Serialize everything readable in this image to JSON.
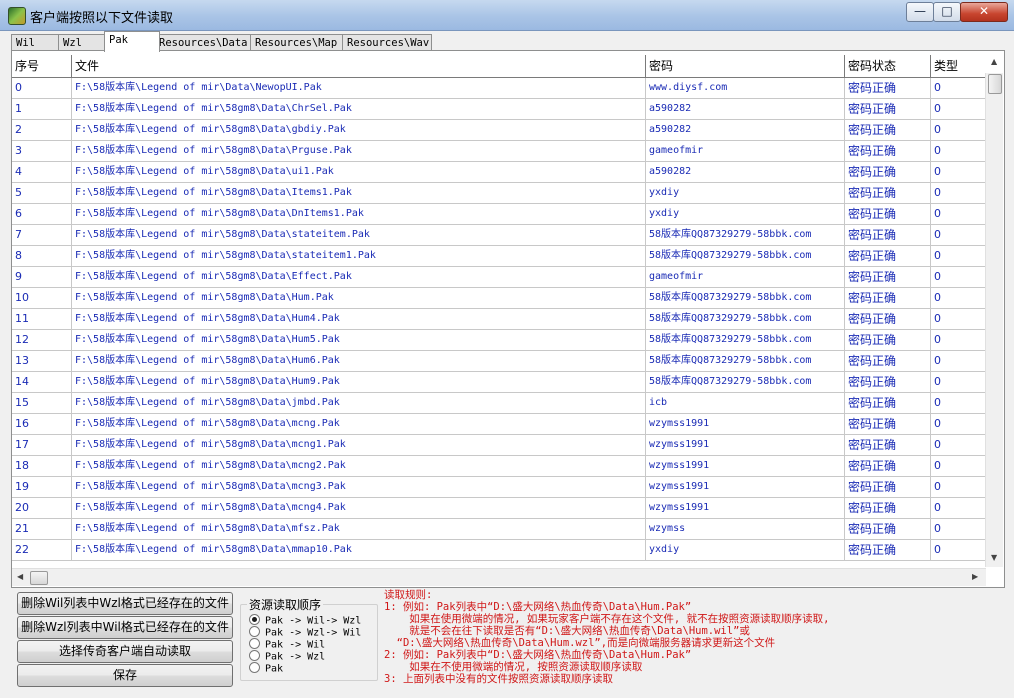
{
  "window": {
    "title": "客户端按照以下文件读取",
    "minimize": "—",
    "maximize": "□",
    "close": "✕"
  },
  "tabs": [
    "Wil",
    "Wzl",
    "Pak",
    "Resources\\Data",
    "Resources\\Map",
    "Resources\\Wav"
  ],
  "active_tab": "Pak",
  "table": {
    "headers": [
      "序号",
      "文件",
      "密码",
      "密码状态",
      "类型"
    ],
    "rows": [
      [
        "0",
        "F:\\58版本库\\Legend of mir\\Data\\NewopUI.Pak",
        "www.diysf.com",
        "密码正确",
        "0"
      ],
      [
        "1",
        "F:\\58版本库\\Legend of mir\\58gm8\\Data\\ChrSel.Pak",
        "a590282",
        "密码正确",
        "0"
      ],
      [
        "2",
        "F:\\58版本库\\Legend of mir\\58gm8\\Data\\gbdiy.Pak",
        "a590282",
        "密码正确",
        "0"
      ],
      [
        "3",
        "F:\\58版本库\\Legend of mir\\58gm8\\Data\\Prguse.Pak",
        "gameofmir",
        "密码正确",
        "0"
      ],
      [
        "4",
        "F:\\58版本库\\Legend of mir\\58gm8\\Data\\ui1.Pak",
        "a590282",
        "密码正确",
        "0"
      ],
      [
        "5",
        "F:\\58版本库\\Legend of mir\\58gm8\\Data\\Items1.Pak",
        "yxdiy",
        "密码正确",
        "0"
      ],
      [
        "6",
        "F:\\58版本库\\Legend of mir\\58gm8\\Data\\DnItems1.Pak",
        "yxdiy",
        "密码正确",
        "0"
      ],
      [
        "7",
        "F:\\58版本库\\Legend of mir\\58gm8\\Data\\stateitem.Pak",
        "58版本库QQ87329279-58bbk.com",
        "密码正确",
        "0"
      ],
      [
        "8",
        "F:\\58版本库\\Legend of mir\\58gm8\\Data\\stateitem1.Pak",
        "58版本库QQ87329279-58bbk.com",
        "密码正确",
        "0"
      ],
      [
        "9",
        "F:\\58版本库\\Legend of mir\\58gm8\\Data\\Effect.Pak",
        "gameofmir",
        "密码正确",
        "0"
      ],
      [
        "10",
        "F:\\58版本库\\Legend of mir\\58gm8\\Data\\Hum.Pak",
        "58版本库QQ87329279-58bbk.com",
        "密码正确",
        "0"
      ],
      [
        "11",
        "F:\\58版本库\\Legend of mir\\58gm8\\Data\\Hum4.Pak",
        "58版本库QQ87329279-58bbk.com",
        "密码正确",
        "0"
      ],
      [
        "12",
        "F:\\58版本库\\Legend of mir\\58gm8\\Data\\Hum5.Pak",
        "58版本库QQ87329279-58bbk.com",
        "密码正确",
        "0"
      ],
      [
        "13",
        "F:\\58版本库\\Legend of mir\\58gm8\\Data\\Hum6.Pak",
        "58版本库QQ87329279-58bbk.com",
        "密码正确",
        "0"
      ],
      [
        "14",
        "F:\\58版本库\\Legend of mir\\58gm8\\Data\\Hum9.Pak",
        "58版本库QQ87329279-58bbk.com",
        "密码正确",
        "0"
      ],
      [
        "15",
        "F:\\58版本库\\Legend of mir\\58gm8\\Data\\jmbd.Pak",
        "icb",
        "密码正确",
        "0"
      ],
      [
        "16",
        "F:\\58版本库\\Legend of mir\\58gm8\\Data\\mcng.Pak",
        "wzymss1991",
        "密码正确",
        "0"
      ],
      [
        "17",
        "F:\\58版本库\\Legend of mir\\58gm8\\Data\\mcng1.Pak",
        "wzymss1991",
        "密码正确",
        "0"
      ],
      [
        "18",
        "F:\\58版本库\\Legend of mir\\58gm8\\Data\\mcng2.Pak",
        "wzymss1991",
        "密码正确",
        "0"
      ],
      [
        "19",
        "F:\\58版本库\\Legend of mir\\58gm8\\Data\\mcng3.Pak",
        "wzymss1991",
        "密码正确",
        "0"
      ],
      [
        "20",
        "F:\\58版本库\\Legend of mir\\58gm8\\Data\\mcng4.Pak",
        "wzymss1991",
        "密码正确",
        "0"
      ],
      [
        "21",
        "F:\\58版本库\\Legend of mir\\58gm8\\Data\\mfsz.Pak",
        "wzymss",
        "密码正确",
        "0"
      ],
      [
        "22",
        "F:\\58版本库\\Legend of mir\\58gm8\\Data\\mmap10.Pak",
        "yxdiy",
        "密码正确",
        "0"
      ]
    ]
  },
  "buttons": {
    "delete_wil": "删除Wil列表中Wzl格式已经存在的文件",
    "delete_wzl": "删除Wzl列表中Wil格式已经存在的文件",
    "auto_read": "选择传奇客户端自动读取",
    "save": "保存"
  },
  "read_order": {
    "title": "资源读取顺序",
    "options": [
      "Pak -> Wil-> Wzl",
      "Pak -> Wzl-> Wil",
      "Pak -> Wil",
      "Pak -> Wzl",
      "Pak"
    ],
    "selected": 0
  },
  "rules": [
    "读取规则:",
    "1: 例如: Pak列表中“D:\\盛大网络\\热血传奇\\Data\\Hum.Pak”",
    "    如果在使用微端的情况, 如果玩家客户端不存在这个文件, 就不在按照资源读取顺序读取,",
    "    就是不会在往下读取是否有“D:\\盛大网络\\热血传奇\\Data\\Hum.wil”或",
    "  “D:\\盛大网络\\热血传奇\\Data\\Hum.wzl”,而是向微端服务器请求更新这个文件",
    "2: 例如: Pak列表中“D:\\盛大网络\\热血传奇\\Data\\Hum.Pak”",
    "    如果在不使用微端的情况, 按照资源读取顺序读取",
    "3: 上面列表中没有的文件按照资源读取顺序读取"
  ],
  "colors": {
    "table_text": "#1a2bb5",
    "rules_text": "#d01818"
  }
}
